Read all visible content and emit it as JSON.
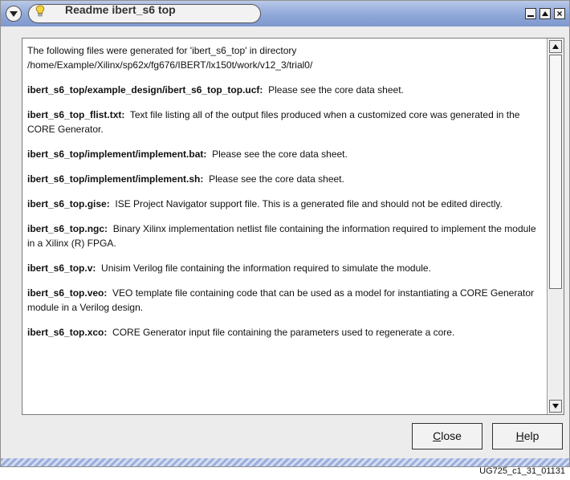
{
  "window": {
    "title": "Readme ibert_s6 top",
    "controls": {
      "minimize_icon": "minimize-icon",
      "maximize_icon": "maximize-icon",
      "close_glyph": "×"
    }
  },
  "readme": {
    "intro_line1": "The following files were generated for 'ibert_s6_top' in directory",
    "intro_line2": "/home/Example/Xilinx/sp62x/fg676/IBERT/lx150t/work/v12_3/trial0/",
    "entries": [
      {
        "name": "ibert_s6_top/example_design/ibert_s6_top_top.ucf:",
        "desc": "Please see the core data sheet."
      },
      {
        "name": "ibert_s6_top_flist.txt:",
        "desc": "Text file listing all of the output files produced when a customized core was generated in the CORE Generator."
      },
      {
        "name": "ibert_s6_top/implement/implement.bat:",
        "desc": "Please see the core data sheet."
      },
      {
        "name": "ibert_s6_top/implement/implement.sh:",
        "desc": "Please see the core data sheet."
      },
      {
        "name": "ibert_s6_top.gise:",
        "desc": "ISE Project Navigator support file. This is a generated file and should not be edited directly."
      },
      {
        "name": "ibert_s6_top.ngc:",
        "desc": "Binary Xilinx implementation netlist file containing the information required to implement the module in a Xilinx (R) FPGA."
      },
      {
        "name": "ibert_s6_top.v:",
        "desc": "Unisim Verilog file containing the information required to simulate the module."
      },
      {
        "name": "ibert_s6_top.veo:",
        "desc": "VEO template file containing code that can be used as a model for instantiating a CORE Generator module in a Verilog design."
      },
      {
        "name": "ibert_s6_top.xco:",
        "desc": "CORE Generator input file containing the parameters used to regenerate a core."
      }
    ]
  },
  "buttons": {
    "close_mnemonic": "C",
    "close_rest": "lose",
    "help_mnemonic": "H",
    "help_rest": "elp"
  },
  "caption": "UG725_c1_31_01131"
}
